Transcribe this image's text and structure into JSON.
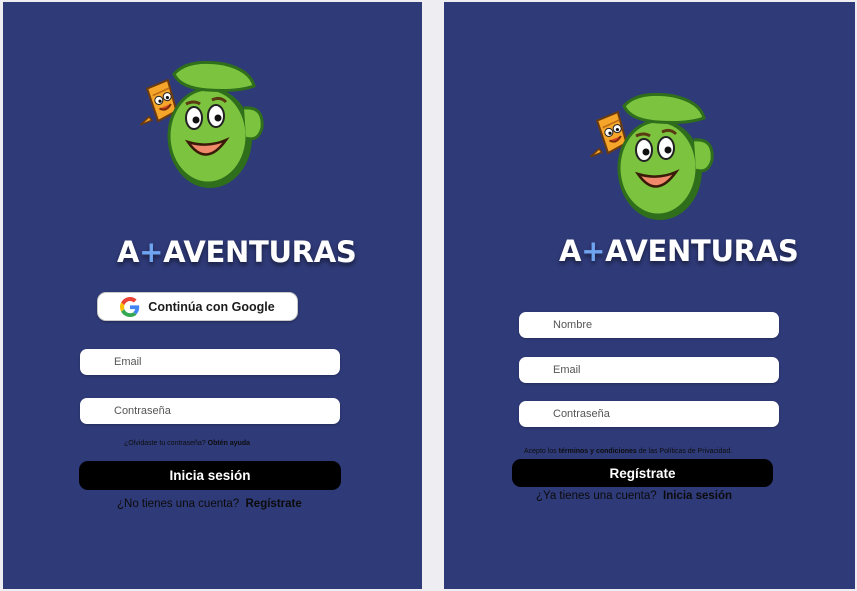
{
  "login": {
    "brand_prefix": "A",
    "brand_plus": "+",
    "brand_name": "AVENTURAS",
    "google_button": "Continúa con Google",
    "email_placeholder": "Email",
    "password_placeholder": "Contraseña",
    "forgot_text": "¿Olvidaste tu contraseña?",
    "forgot_link": "Obtén ayuda",
    "submit_button": "Inicia sesión",
    "switch_text": "¿No tienes una cuenta?",
    "switch_link": "Regístrate"
  },
  "signup": {
    "brand_prefix": "A",
    "brand_plus": "+",
    "brand_name": "AVENTURAS",
    "name_placeholder": "Nombre",
    "email_placeholder": "Email",
    "password_placeholder": "Contraseña",
    "terms_prefix": "Acepto los",
    "terms_link": "términos y condiciones",
    "terms_suffix": "de las Políticas de Privacidad.",
    "submit_button": "Regístrate",
    "switch_text": "¿Ya tienes una cuenta?",
    "switch_link": "Inicia sesión"
  },
  "colors": {
    "panel_bg": "#2f3a78",
    "page_bg": "#eeeef2",
    "button_bg": "#000000",
    "brand_plus": "#6fa4f0",
    "mascot_green": "#7cc33f"
  },
  "icons": {
    "google": "google-g-icon",
    "mascot": "backpack-mascot-icon"
  }
}
